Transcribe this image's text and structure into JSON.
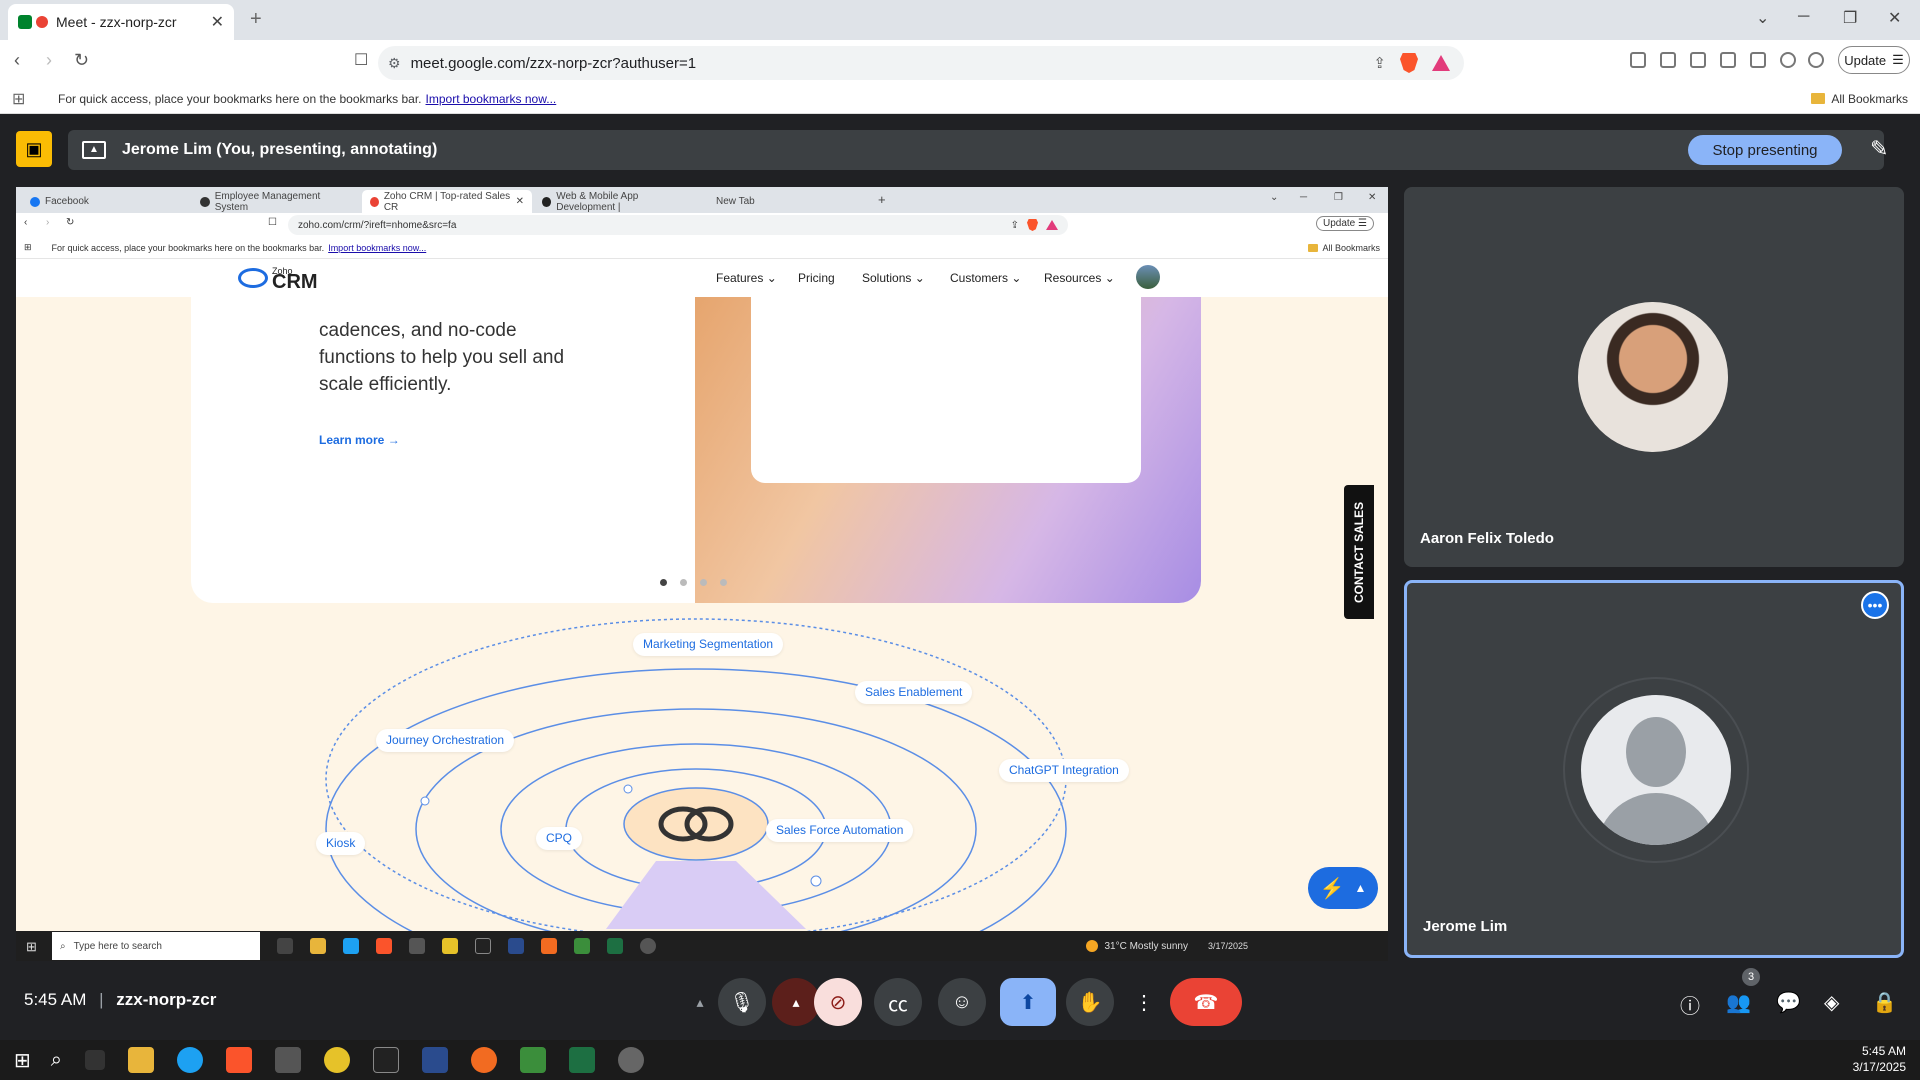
{
  "browser": {
    "tab_title": "Meet - zzx-norp-zcr",
    "url": "meet.google.com/zzx-norp-zcr?authuser=1",
    "update_label": "Update",
    "bookmarks_msg": "For quick access, place your bookmarks here on the bookmarks bar.",
    "bookmarks_link": "Import bookmarks now...",
    "all_bookmarks": "All Bookmarks"
  },
  "meet": {
    "presenter_label": "Jerome Lim (You, presenting, annotating)",
    "stop_presenting": "Stop presenting",
    "time": "5:45 AM",
    "meeting_code": "zzx-norp-zcr",
    "participants_count": "3",
    "participants": [
      {
        "name": "Aaron Felix Toledo"
      },
      {
        "name": "Jerome Lim"
      }
    ]
  },
  "shared": {
    "tabs": [
      {
        "label": "Facebook",
        "color": "#1877f2"
      },
      {
        "label": "Employee Management System",
        "color": "#333333"
      },
      {
        "label": "Zoho CRM | Top-rated Sales CR",
        "color": "#ea4335"
      },
      {
        "label": "Web & Mobile App Development |",
        "color": "#222222"
      },
      {
        "label": "New Tab",
        "color": ""
      }
    ],
    "url": "zoho.com/crm/?ireft=nhome&src=fa",
    "update_label": "Update",
    "bookmarks_msg": "For quick access, place your bookmarks here on the bookmarks bar.",
    "bookmarks_link": "Import bookmarks now...",
    "all_bookmarks": "All Bookmarks",
    "zoho": {
      "logo_small": "Zoho",
      "logo_big": "CRM",
      "nav": [
        "Features",
        "Pricing",
        "Solutions",
        "Customers",
        "Resources"
      ],
      "body_text": "cadences, and no-code functions to help you sell and scale efficiently.",
      "learn_more": "Learn more →",
      "contact_sales": "CONTACT SALES",
      "carousel_active": 1,
      "carousel_total": 4,
      "orbit_labels": {
        "marketing": "Marketing Segmentation",
        "sales_enablement": "Sales Enablement",
        "journey": "Journey Orchestration",
        "chatgpt": "ChatGPT Integration",
        "kiosk": "Kiosk",
        "cpq": "CPQ",
        "sfa": "Sales Force Automation"
      }
    },
    "taskbar": {
      "search_placeholder": "Type here to search",
      "weather": "31°C  Mostly sunny",
      "date": "3/17/2025"
    }
  },
  "os": {
    "time": "5:45 AM",
    "date": "3/17/2025"
  },
  "colors": {
    "meet_bg": "#202124",
    "stop_btn": "#8ab4f8",
    "end_call": "#ea4335",
    "present_active": "#8ab4f8",
    "zoho_blue": "#1d6ce0"
  }
}
